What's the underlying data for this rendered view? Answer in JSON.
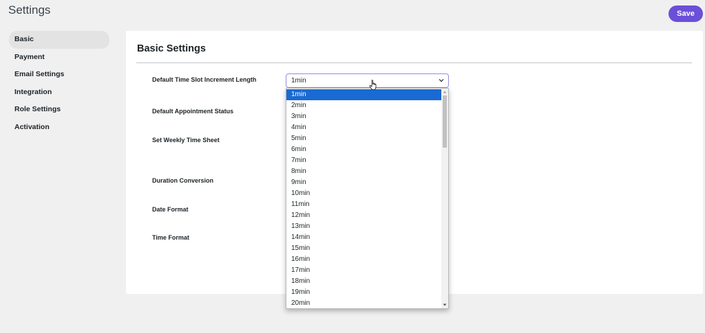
{
  "page": {
    "title": "Settings"
  },
  "header": {
    "save_label": "Save"
  },
  "sidebar": {
    "items": [
      {
        "label": "Basic",
        "active": true
      },
      {
        "label": "Payment"
      },
      {
        "label": "Email Settings"
      },
      {
        "label": "Integration"
      },
      {
        "label": "Role Settings"
      },
      {
        "label": "Activation"
      }
    ]
  },
  "panel": {
    "title": "Basic Settings",
    "fields": [
      {
        "label": "Default Time Slot Increment Length"
      },
      {
        "label": "Default Appointment Status"
      },
      {
        "label": "Set Weekly Time Sheet"
      },
      {
        "label": "Duration Conversion"
      },
      {
        "label": "Date Format"
      },
      {
        "label": "Time Format"
      }
    ]
  },
  "increment_select": {
    "value": "1min",
    "options": [
      "1min",
      "2min",
      "3min",
      "4min",
      "5min",
      "6min",
      "7min",
      "8min",
      "9min",
      "10min",
      "11min",
      "12min",
      "13min",
      "14min",
      "15min",
      "16min",
      "17min",
      "18min",
      "19min",
      "20min"
    ],
    "selected_index": 0
  },
  "colors": {
    "accent": "#6b4fd8",
    "selection": "#1a6ad3",
    "background": "#f0f0f1"
  }
}
